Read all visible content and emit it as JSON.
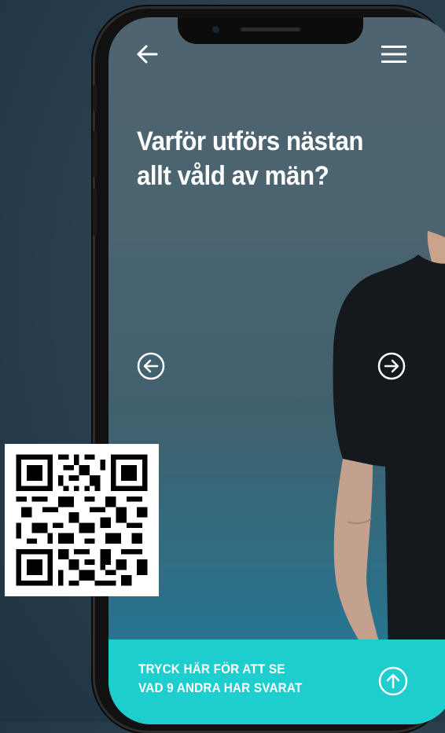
{
  "app": {
    "headline_line1": "Varför utförs nästan",
    "headline_line2": "allt våld av män?",
    "cta_line1": "TRYCK HÄR FÖR ATT SE",
    "cta_line2": "VAD 9 ANDRA HAR SVARAT"
  },
  "icons": {
    "back": "arrow-left-icon",
    "menu": "hamburger-menu-icon",
    "prev": "circle-arrow-left-icon",
    "next": "circle-arrow-right-icon",
    "expand": "circle-arrow-up-icon"
  },
  "colors": {
    "cta_background": "#1ecdcd",
    "text": "#ffffff",
    "shirt": "#14191d"
  }
}
